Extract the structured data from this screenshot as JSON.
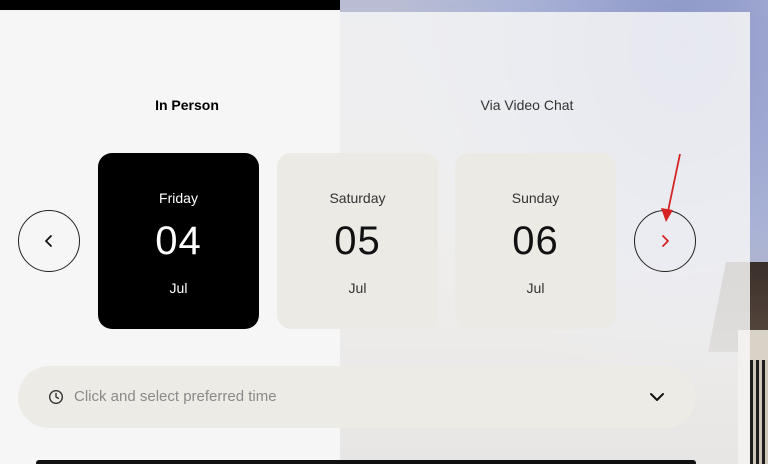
{
  "tabs": [
    {
      "label": "In Person",
      "active": true
    },
    {
      "label": "Via Video Chat",
      "active": false
    }
  ],
  "dates": [
    {
      "weekday": "Friday",
      "day": "04",
      "month": "Jul",
      "selected": true
    },
    {
      "weekday": "Saturday",
      "day": "05",
      "month": "Jul",
      "selected": false
    },
    {
      "weekday": "Sunday",
      "day": "06",
      "month": "Jul",
      "selected": false
    }
  ],
  "nav": {
    "prev_icon": "chevron-left-icon",
    "next_icon": "chevron-right-icon"
  },
  "time_select": {
    "placeholder": "Click and select preferred time",
    "icon": "clock-icon",
    "dropdown_icon": "chevron-down-icon"
  },
  "colors": {
    "selected_card": "#000000",
    "card": "#eceae5",
    "annotation_arrow": "#d62222"
  }
}
